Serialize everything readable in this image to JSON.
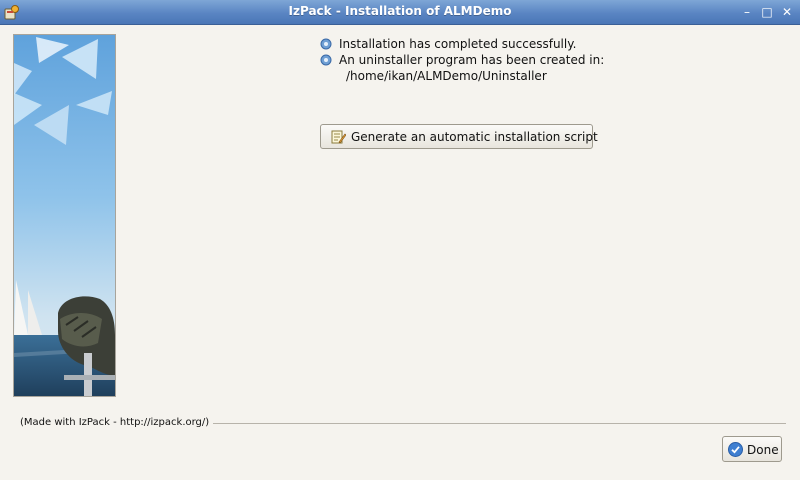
{
  "window": {
    "title": "IzPack - Installation of ALMDemo",
    "controls": {
      "minimize": "–",
      "maximize": "□",
      "close": "✕"
    }
  },
  "messages": [
    {
      "icon": "gear-icon",
      "text": "Installation has completed successfully."
    },
    {
      "icon": "gear-icon",
      "text": "An uninstaller program has been created in:"
    }
  ],
  "uninstaller_path": "/home/ikan/ALMDemo/Uninstaller",
  "generate_button": {
    "icon": "script-edit-icon",
    "label": "Generate an automatic installation script"
  },
  "footer": {
    "made_with": "(Made with IzPack - http://izpack.org/)"
  },
  "done_button": {
    "icon": "checkmark-icon",
    "label": "Done"
  },
  "colors": {
    "titlebar": "#5a85c3",
    "background": "#f5f3ee",
    "banner_sky": "#8fc3ea"
  }
}
